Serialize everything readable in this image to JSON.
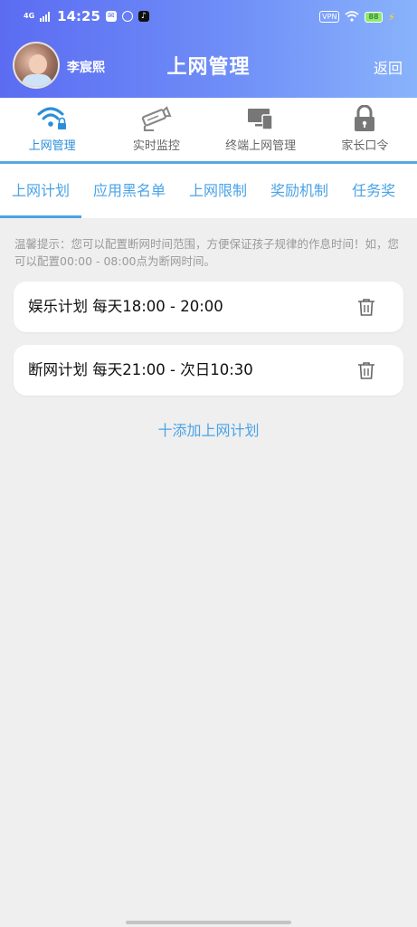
{
  "status_bar": {
    "network": "4G",
    "time": "14:25",
    "vpn": "VPN",
    "battery": "88"
  },
  "header": {
    "username": "李宸熙",
    "title": "上网管理",
    "back_label": "返回"
  },
  "nav": {
    "items": [
      {
        "label": "上网管理",
        "icon": "wifi-lock-icon"
      },
      {
        "label": "实时监控",
        "icon": "camera-icon"
      },
      {
        "label": "终端上网管理",
        "icon": "devices-icon"
      },
      {
        "label": "家长口令",
        "icon": "lock-icon"
      }
    ]
  },
  "subtabs": [
    "上网计划",
    "应用黑名单",
    "上网限制",
    "奖励机制",
    "任务奖"
  ],
  "tip": "温馨提示：您可以配置断网时间范围，方便保证孩子规律的作息时间！如，您可以配置00:00 - 08:00点为断网时间。",
  "plans": [
    {
      "text": "娱乐计划 每天18:00 - 20:00"
    },
    {
      "text": "断网计划 每天21:00 - 次日10:30"
    }
  ],
  "add_plan_label": "十添加上网计划",
  "colors": {
    "header_start": "#5b6cf2",
    "header_end": "#89b3fb",
    "accent": "#4aa3e6",
    "background": "#efefef"
  }
}
